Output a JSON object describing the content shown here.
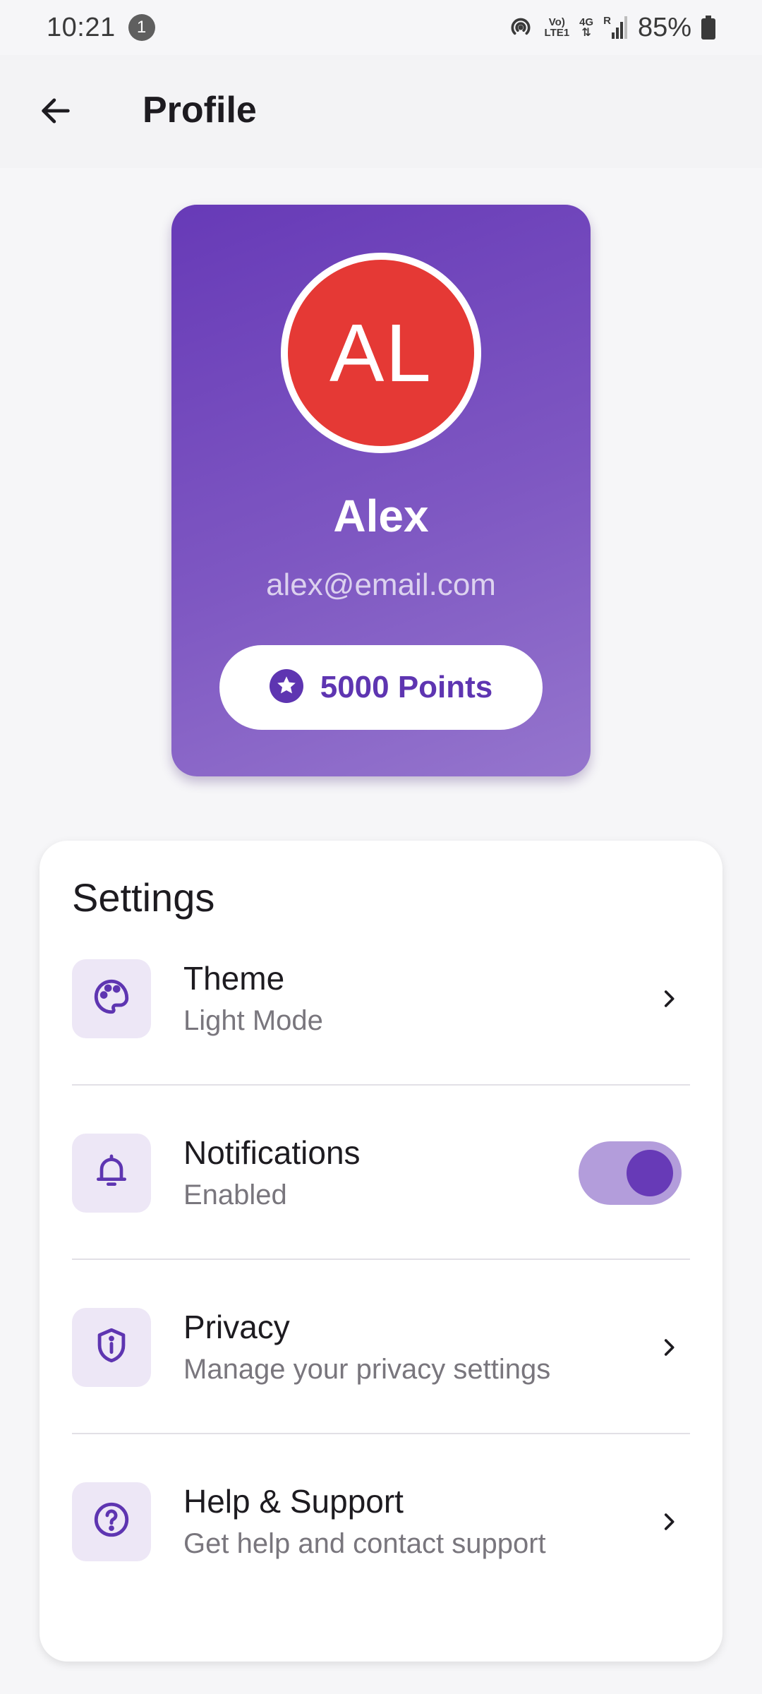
{
  "status_bar": {
    "time": "10:21",
    "notification_count": "1",
    "network_label_top": "Vo)",
    "network_label_bottom": "LTE1",
    "network_type": "4G",
    "roaming": "R",
    "battery": "85%"
  },
  "app_bar": {
    "title": "Profile",
    "back_icon": "arrow-back-icon"
  },
  "profile": {
    "initials": "AL",
    "name": "Alex",
    "email": "alex@email.com",
    "points": "5000 Points",
    "avatar_color": "#e53935",
    "gradient_start": "#673ab7",
    "gradient_end": "#9575cd"
  },
  "settings": {
    "title": "Settings",
    "items": [
      {
        "icon": "palette-icon",
        "title": "Theme",
        "subtitle": "Light Mode",
        "trailing": "chevron"
      },
      {
        "icon": "bell-icon",
        "title": "Notifications",
        "subtitle": "Enabled",
        "trailing": "toggle",
        "toggle_on": true
      },
      {
        "icon": "shield-info-icon",
        "title": "Privacy",
        "subtitle": "Manage your privacy settings",
        "trailing": "chevron"
      },
      {
        "icon": "help-circle-icon",
        "title": "Help & Support",
        "subtitle": "Get help and contact support",
        "trailing": "chevron"
      }
    ]
  },
  "colors": {
    "accent": "#673ab7",
    "icon_tile_bg": "#ede7f6",
    "toggle_track": "#b39ddb"
  }
}
